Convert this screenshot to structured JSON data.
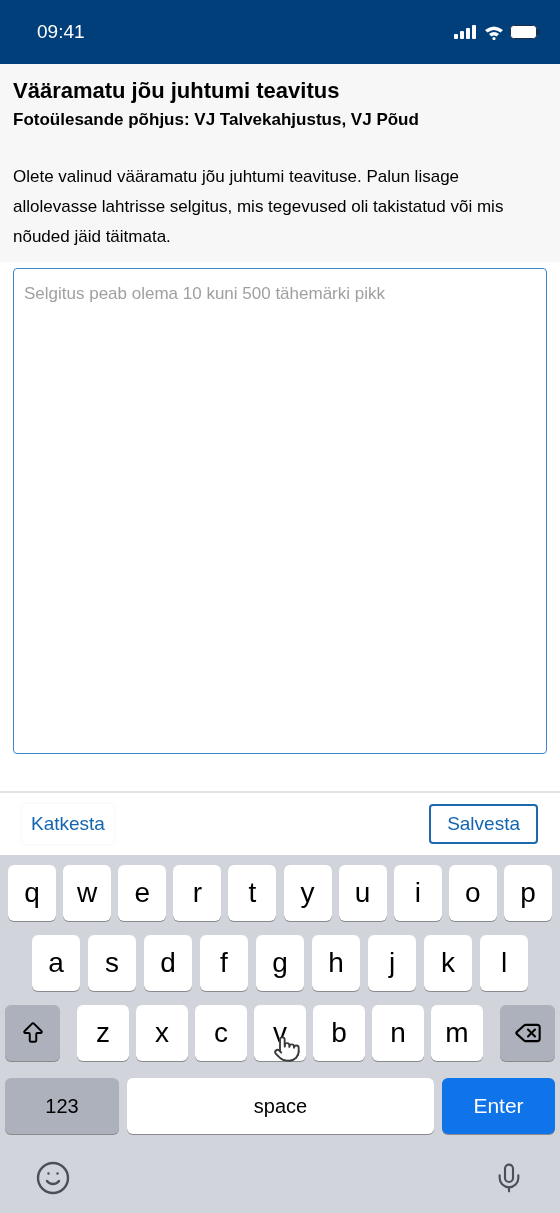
{
  "status_bar": {
    "time": "09:41"
  },
  "header": {
    "title": "Vääramatu jõu juhtumi teavitus",
    "subtitle": "Fotoülesande põhjus: VJ Talvekahjustus, VJ Põud",
    "message": "Olete valinud vääramatu jõu juhtumi teavituse. Palun lisage allolevasse lahtrisse selgitus, mis tegevused oli takistatud või mis nõuded jäid täitmata."
  },
  "explanation_field": {
    "placeholder": "Selgitus peab olema 10 kuni 500 tähemärki pikk"
  },
  "actions": [
    {
      "label": "Katkesta",
      "kind": "text"
    },
    {
      "label": "Salvesta",
      "kind": "outlined"
    }
  ],
  "keyboard": {
    "rows": [
      [
        "q",
        "w",
        "e",
        "r",
        "t",
        "y",
        "u",
        "i",
        "o",
        "p"
      ],
      [
        "a",
        "s",
        "d",
        "f",
        "g",
        "h",
        "j",
        "k",
        "l"
      ],
      [
        "z",
        "x",
        "c",
        "v",
        "b",
        "n",
        "m"
      ]
    ],
    "bottom_row": [
      {
        "label": "123",
        "kind": "mode"
      },
      {
        "label": "space",
        "kind": "space"
      },
      {
        "label": "Enter",
        "kind": "primary"
      }
    ]
  }
}
